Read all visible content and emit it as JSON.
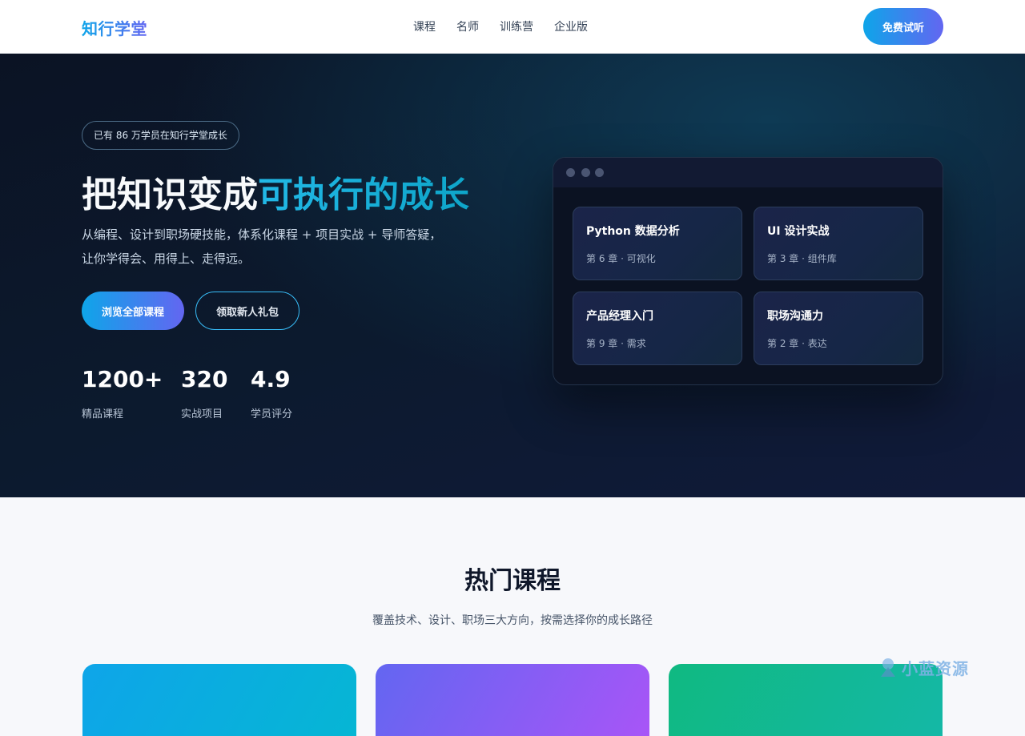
{
  "header": {
    "logo": "知行学堂",
    "nav": [
      "课程",
      "名师",
      "训练营",
      "企业版"
    ],
    "cta": "免费试听"
  },
  "hero": {
    "badge": "已有 86 万学员在知行学堂成长",
    "headline_main": "把知识变成",
    "headline_accent": "可执行的成长",
    "subtext_line1": "从编程、设计到职场硬技能，体系化课程 + 项目实战 + 导师答疑，",
    "subtext_line2": "让你学得会、用得上、走得远。",
    "primary_button": "浏览全部课程",
    "secondary_button": "领取新人礼包",
    "stats": [
      {
        "value": "1200+",
        "label": "精品课程"
      },
      {
        "value": "320",
        "label": "实战项目"
      },
      {
        "value": "4.9",
        "label": "学员评分"
      }
    ]
  },
  "preview": {
    "cards": [
      {
        "title": "Python 数据分析",
        "subtitle": "第 6 章 · 可视化"
      },
      {
        "title": "UI 设计实战",
        "subtitle": "第 3 章 · 组件库"
      },
      {
        "title": "产品经理入门",
        "subtitle": "第 9 章 · 需求"
      },
      {
        "title": "职场沟通力",
        "subtitle": "第 2 章 · 表达"
      }
    ]
  },
  "section": {
    "title": "热门课程",
    "subtitle": "覆盖技术、设计、职场三大方向，按需选择你的成长路径"
  },
  "watermark": "小蓝资源",
  "colors": {
    "brand_gradient_start": "#0ea5e9",
    "brand_gradient_end": "#6366f1",
    "hero_bg": "#0b1324",
    "accent_text": "#22b8e6"
  }
}
